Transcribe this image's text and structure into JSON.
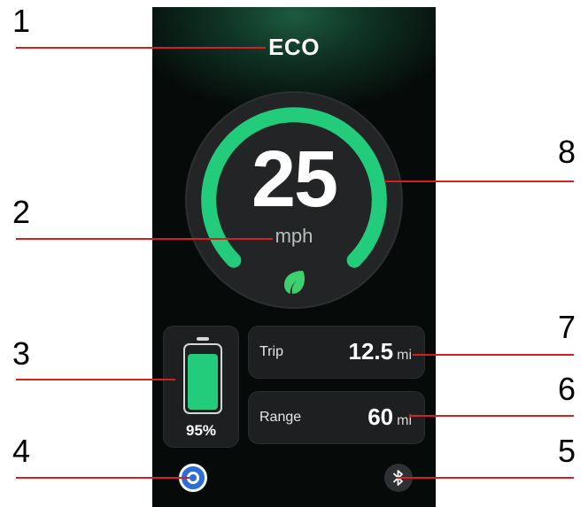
{
  "screen": {
    "mode_label": "ECO",
    "speed": "25",
    "speed_unit": "mph",
    "speed_gauge_fill": 0.85,
    "mode_icon": "leaf-icon",
    "battery": {
      "percent_label": "95%",
      "level": 0.95
    },
    "trip": {
      "label": "Trip",
      "value": "12.5",
      "unit": "mi"
    },
    "range": {
      "label": "Range",
      "value": "60",
      "unit": "mi"
    },
    "nav_icon": "navigation-icon",
    "bluetooth_icon": "bluetooth-icon"
  },
  "annotations": [
    "1",
    "2",
    "3",
    "4",
    "5",
    "6",
    "7",
    "8"
  ],
  "colors": {
    "accent_green": "#22cc7a",
    "annotation_red": "#d62020",
    "card_bg": "#1e1f21",
    "nav_blue": "#2e6cd6"
  }
}
